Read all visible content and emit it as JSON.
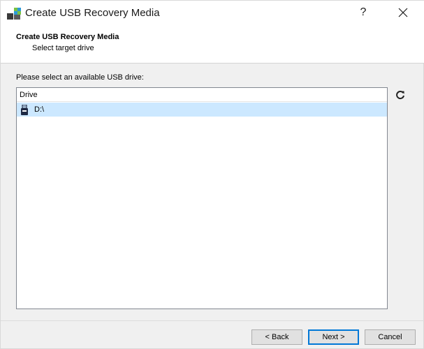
{
  "window": {
    "title": "Create USB Recovery Media",
    "help_label": "?"
  },
  "header": {
    "title": "Create USB Recovery Media",
    "subtitle": "Select target drive"
  },
  "main": {
    "prompt": "Please select an available USB drive:",
    "columns": [
      "Drive"
    ],
    "drives": [
      {
        "label": "D:\\",
        "selected": true
      }
    ]
  },
  "footer": {
    "back_label": "< Back",
    "next_label": "Next >",
    "cancel_label": "Cancel"
  },
  "colors": {
    "selection": "#cce8ff",
    "default_button_border": "#0078d7"
  },
  "icons": {
    "app": "usb-recovery-app-icon",
    "drive": "usb-drive-icon",
    "refresh": "refresh-icon",
    "close": "close-icon"
  }
}
